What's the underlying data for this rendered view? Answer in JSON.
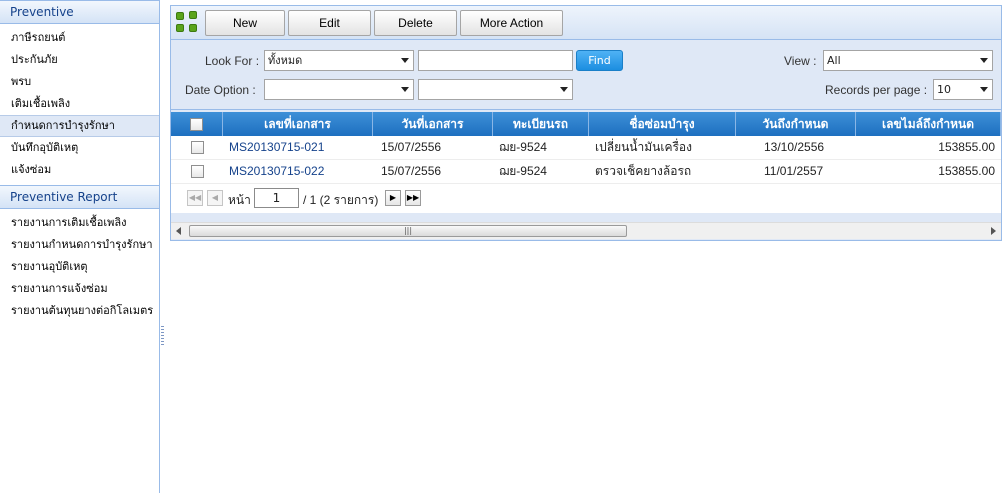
{
  "sidebar": {
    "sections": [
      {
        "title": "Preventive",
        "items": [
          {
            "label": "ภาษีรถยนต์"
          },
          {
            "label": "ประกันภัย"
          },
          {
            "label": "พรบ"
          },
          {
            "label": "เติมเชื้อเพลิง"
          },
          {
            "label": "กำหนดการบำรุงรักษา",
            "selected": true
          },
          {
            "label": "บันทึกอุบัติเหตุ"
          },
          {
            "label": "แจ้งซ่อม"
          }
        ]
      },
      {
        "title": "Preventive Report",
        "items": [
          {
            "label": "รายงานการเติมเชื้อเพลิง"
          },
          {
            "label": "รายงานกำหนดการบำรุงรักษา"
          },
          {
            "label": "รายงานอุบัติเหตุ"
          },
          {
            "label": "รายงานการแจ้งซ่อม"
          },
          {
            "label": "รายงานต้นทุนยางต่อกิโลเมตร"
          }
        ]
      }
    ]
  },
  "toolbar": {
    "new_label": "New",
    "edit_label": "Edit",
    "delete_label": "Delete",
    "more_label": "More Action"
  },
  "filters": {
    "look_for_label": "Look For :",
    "look_for_value": "ทั้งหมด",
    "search_value": "",
    "find_label": "Find",
    "date_option_label": "Date Option :",
    "date_option_value": "",
    "date_option2_value": "",
    "view_label": "View :",
    "view_value": "All",
    "records_label": "Records per page :",
    "records_value": "10"
  },
  "grid": {
    "columns": [
      "เลขที่เอกสาร",
      "วันที่เอกสาร",
      "ทะเบียนรถ",
      "ชื่อซ่อมบำรุง",
      "วันถึงกำหนด",
      "เลขไมล์ถึงกำหนด"
    ],
    "rows": [
      [
        "MS20130715-021",
        "15/07/2556",
        "ฌย-9524",
        "เปลี่ยนน้ำมันเครื่อง",
        "13/10/2556",
        "153855.00"
      ],
      [
        "MS20130715-022",
        "15/07/2556",
        "ฌย-9524",
        "ตรวจเช็คยางล้อรถ",
        "11/01/2557",
        "153855.00"
      ]
    ]
  },
  "pager": {
    "page_label": "หน้า",
    "page_value": "1",
    "total_text": "/ 1 (2 รายการ)"
  },
  "colors": {
    "header_blue": "#1d6fc0",
    "accent": "#1c8ee0",
    "panel_border": "#99bbe8"
  }
}
